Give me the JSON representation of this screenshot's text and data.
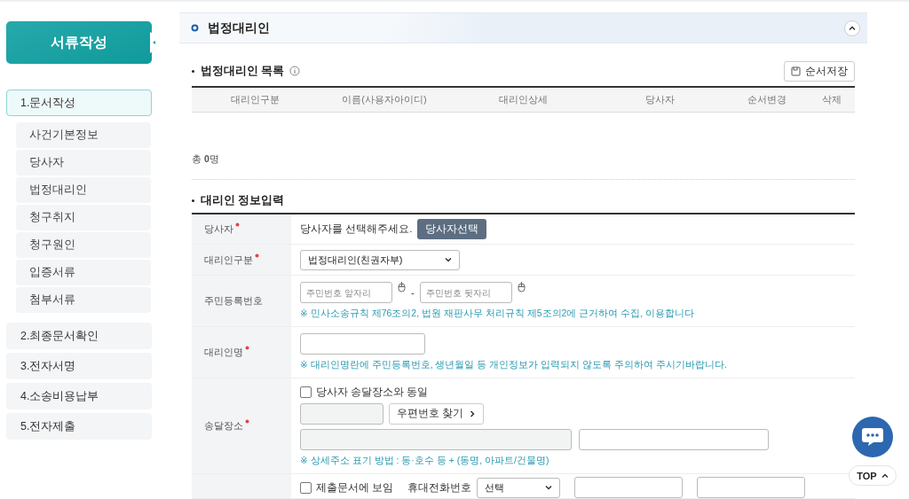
{
  "sidebar": {
    "title": "서류작성",
    "steps": [
      {
        "label": "1.문서작성",
        "selected": true,
        "children": [
          {
            "label": "사건기본정보",
            "selected": false
          },
          {
            "label": "당사자",
            "selected": false
          },
          {
            "label": "법정대리인",
            "selected": false
          },
          {
            "label": "청구취지",
            "selected": false
          },
          {
            "label": "청구원인",
            "selected": false
          },
          {
            "label": "입증서류",
            "selected": false
          },
          {
            "label": "첨부서류",
            "selected": false
          }
        ]
      },
      {
        "label": "2.최종문서확인",
        "selected": false
      },
      {
        "label": "3.전자서명",
        "selected": false
      },
      {
        "label": "4.소송비용납부",
        "selected": false
      },
      {
        "label": "5.전자제출",
        "selected": false
      }
    ]
  },
  "section": {
    "title": "법정대리인",
    "expanded": true
  },
  "list": {
    "title": "법정대리인 목록",
    "save_button": "순서저장",
    "columns": [
      "대리인구분",
      "이름(사용자아이디)",
      "대리인상세",
      "당사자",
      "순서변경",
      "삭제"
    ],
    "total": "총 **0**명"
  },
  "form": {
    "title": "대리인 정보입력",
    "rows": [
      {
        "kind": "party",
        "label": "당사자",
        "required": true,
        "text": "당사자를 선택해주세요.",
        "button": "당사자선택"
      },
      {
        "kind": "select",
        "label": "대리인구분",
        "required": true,
        "value": "법정대리인(친권자부)"
      },
      {
        "kind": "id_number",
        "label": "주민등록번호",
        "required": false,
        "front_placeholder": "주민번호 앞자리",
        "separator": "-",
        "back_placeholder": "주민번호 뒷자리",
        "note": "※ 민사소송규칙 제76조의2, 법원 재판사무 처리규칙 제5조의2에 근거하여 수집, 이용합니다"
      },
      {
        "kind": "name",
        "label": "대리인명",
        "required": true,
        "note": "※ 대리인명란에 주민등록번호, 생년월일 등 개인정보가 입력되지 않도록 주의하여 주시기바랍니다."
      },
      {
        "kind": "address",
        "label": "송달장소",
        "required": true,
        "same_checkbox": {
          "label": "당사자 송달장소와 동일",
          "checked": false
        },
        "zip_button": "우편번호 찾기",
        "note": "※ 상세주소 표기 방법 : 동·호수 등 + (동명, 아파트/건물명)"
      },
      {
        "kind": "phone",
        "checkbox": {
          "label": "제출문서에 보임",
          "checked": false
        },
        "phone_label": "휴대전화번호",
        "select": "선택"
      }
    ]
  },
  "top_button": "TOP"
}
